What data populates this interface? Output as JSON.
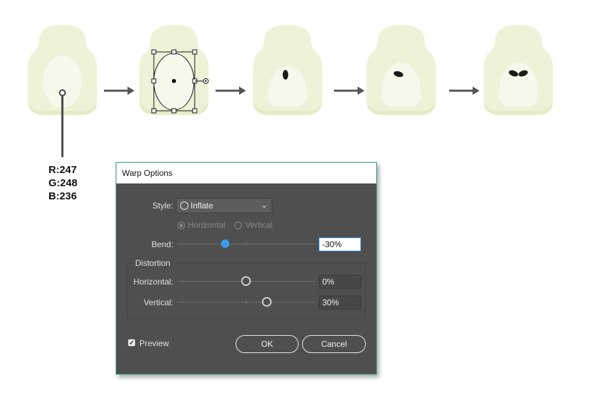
{
  "annotation": {
    "r": "R:247",
    "g": "G:248",
    "b": "B:236"
  },
  "artwork": {
    "face_color": "#eef2d9",
    "face_shadow": "#e4ecc4",
    "muzzle_color": "#f7f8ec",
    "ear_color": "#2f2f2f",
    "arrow_color": "#333333",
    "selection_color": "#111111"
  },
  "dialog": {
    "title": "Warp Options",
    "style_label": "Style:",
    "style_value": "Inflate",
    "orientation_horizontal": "Horizontal",
    "orientation_vertical": "Vertical",
    "bend_label": "Bend:",
    "bend_value": "-30%",
    "bend_level_percent": -30,
    "distortion_label": "Distortion",
    "horizontal_label": "Horizontal:",
    "horizontal_value": "0%",
    "horizontal_level_percent": 0,
    "vertical_label": "Vertical:",
    "vertical_value": "30%",
    "vertical_level_percent": 30,
    "preview_label": "Preview",
    "preview_checked": true,
    "ok_label": "OK",
    "cancel_label": "Cancel",
    "accent": "#3d9cf0"
  }
}
